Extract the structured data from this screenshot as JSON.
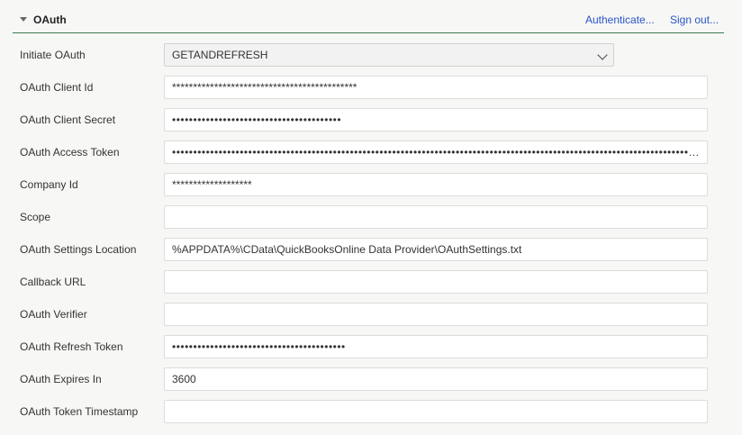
{
  "section": {
    "title": "OAuth",
    "authenticate_label": "Authenticate...",
    "signout_label": "Sign out..."
  },
  "fields": [
    {
      "label": "Initiate OAuth",
      "value": "GETANDREFRESH",
      "type": "select"
    },
    {
      "label": "OAuth Client Id",
      "value": "********************************************",
      "type": "text"
    },
    {
      "label": "OAuth Client Secret",
      "value": "••••••••••••••••••••••••••••••••••••••••",
      "type": "password"
    },
    {
      "label": "OAuth Access Token",
      "value": "••••••••••••••••••••••••••••••••••••••••••••••••••••••••••••••••••••••••••••••••••••••••••••••••••••••••••••••••••••••••••••••••••••••••••••••••••••••••••••••••••",
      "type": "password"
    },
    {
      "label": "Company Id",
      "value": "*******************",
      "type": "text"
    },
    {
      "label": "Scope",
      "value": "",
      "type": "text"
    },
    {
      "label": "OAuth Settings Location",
      "value": "%APPDATA%\\CData\\QuickBooksOnline Data Provider\\OAuthSettings.txt",
      "type": "text"
    },
    {
      "label": "Callback URL",
      "value": "",
      "type": "text"
    },
    {
      "label": "OAuth Verifier",
      "value": "",
      "type": "text"
    },
    {
      "label": "OAuth Refresh Token",
      "value": "•••••••••••••••••••••••••••••••••••••••••",
      "type": "password"
    },
    {
      "label": "OAuth Expires In",
      "value": "3600",
      "type": "text"
    },
    {
      "label": "OAuth Token Timestamp",
      "value": "",
      "type": "text"
    }
  ]
}
